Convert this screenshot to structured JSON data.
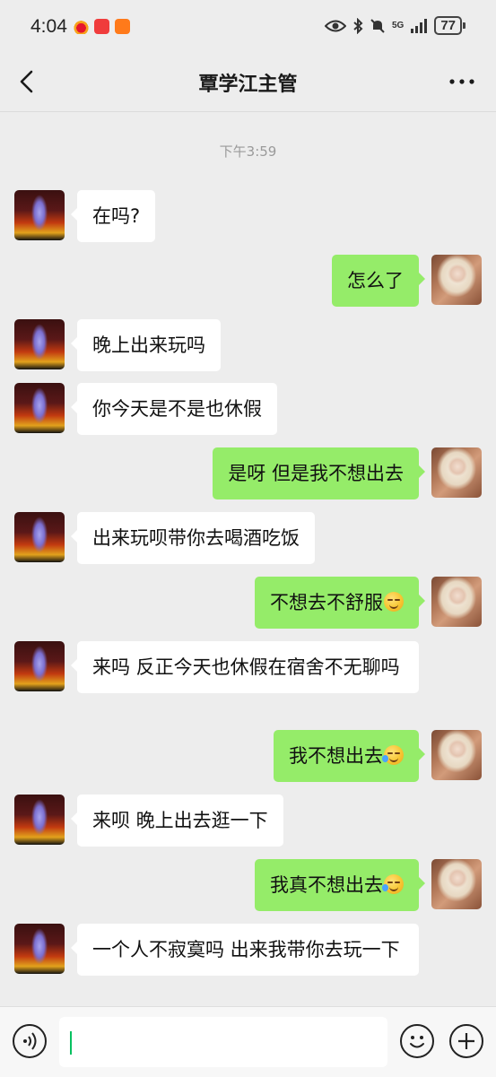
{
  "status_bar": {
    "time": "4:04",
    "network": "5G",
    "battery": "77"
  },
  "header": {
    "title": "覃学江主管"
  },
  "chat": {
    "timestamp": "下午3:59",
    "messages": [
      {
        "side": "left",
        "text": "在吗?"
      },
      {
        "side": "right",
        "text": "怎么了"
      },
      {
        "side": "left",
        "text": "晚上出来玩吗"
      },
      {
        "side": "left",
        "text": "你今天是不是也休假"
      },
      {
        "side": "right",
        "text": "是呀 但是我不想出去"
      },
      {
        "side": "left",
        "text": "出来玩呗带你去喝酒吃饭"
      },
      {
        "side": "right",
        "text": "不想去不舒服",
        "emoji": "pensive-emoji"
      },
      {
        "side": "left",
        "text": "来吗 反正今天也休假在宿舍不无聊吗"
      },
      {
        "side": "right",
        "text": "我不想出去",
        "emoji": "crying-emoji"
      },
      {
        "side": "left",
        "text": "来呗 晚上出去逛一下"
      },
      {
        "side": "right",
        "text": "我真不想出去",
        "emoji": "crying-emoji"
      },
      {
        "side": "left",
        "text": "一个人不寂寞吗 出来我带你去玩一下"
      }
    ]
  },
  "input_bar": {
    "value": ""
  },
  "colors": {
    "background": "#ededed",
    "sent_bubble": "#95ec69",
    "received_bubble": "#ffffff",
    "caret": "#07c160"
  }
}
